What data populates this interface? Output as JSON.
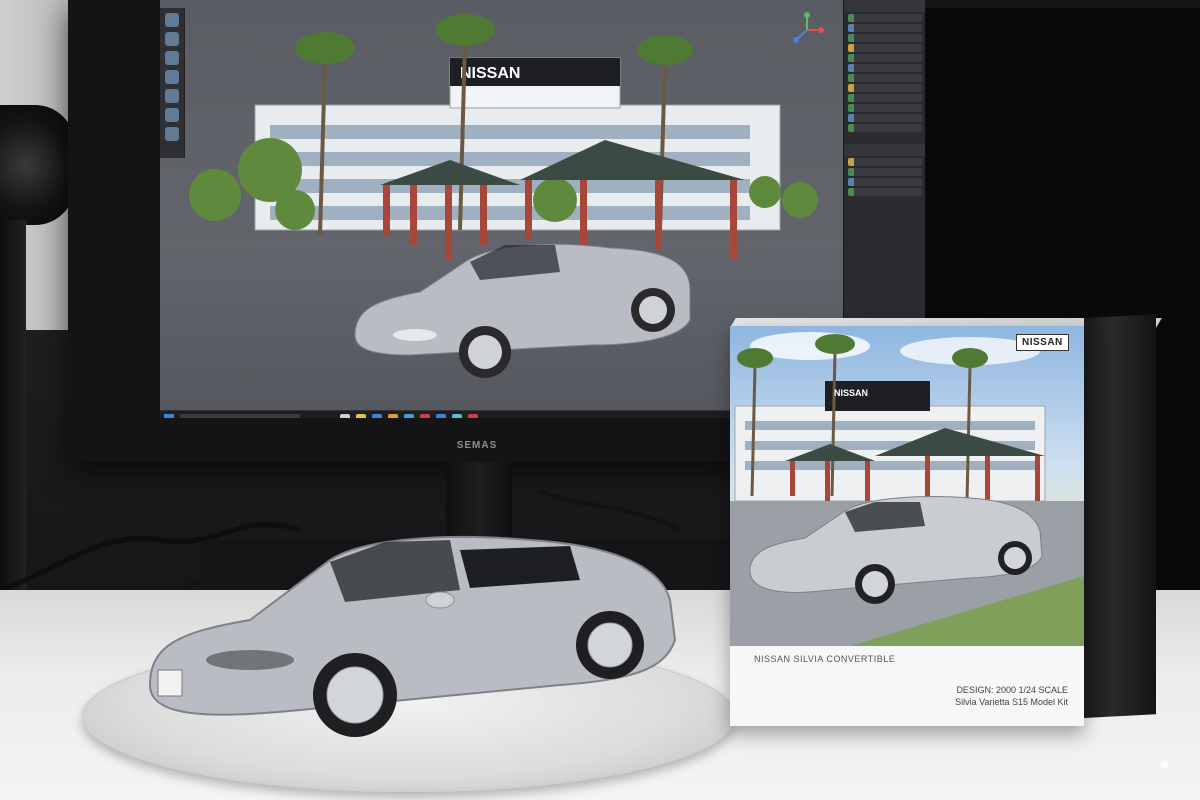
{
  "scene": {
    "monitor_brand": "SEMAS",
    "screen_building_sign": "NISSAN",
    "box_logo": "NISSAN",
    "box_building_sign": "NISSAN",
    "box_caption": "NISSAN SILVIA CONVERTIBLE",
    "box_code_line1": "DESIGN: 2000 1/24 SCALE",
    "box_code_line2": "Silvia Varietta S15 Model Kit",
    "sparkle_icon": "sparkle-icon"
  },
  "colors": {
    "car_silver": "#b9bcc2",
    "car_shadow": "#7d8188",
    "pillar_red": "#a8463a",
    "roof_dark": "#3b4a42",
    "palm_green": "#4f7a34",
    "sky_blue": "#8fb6e0"
  }
}
